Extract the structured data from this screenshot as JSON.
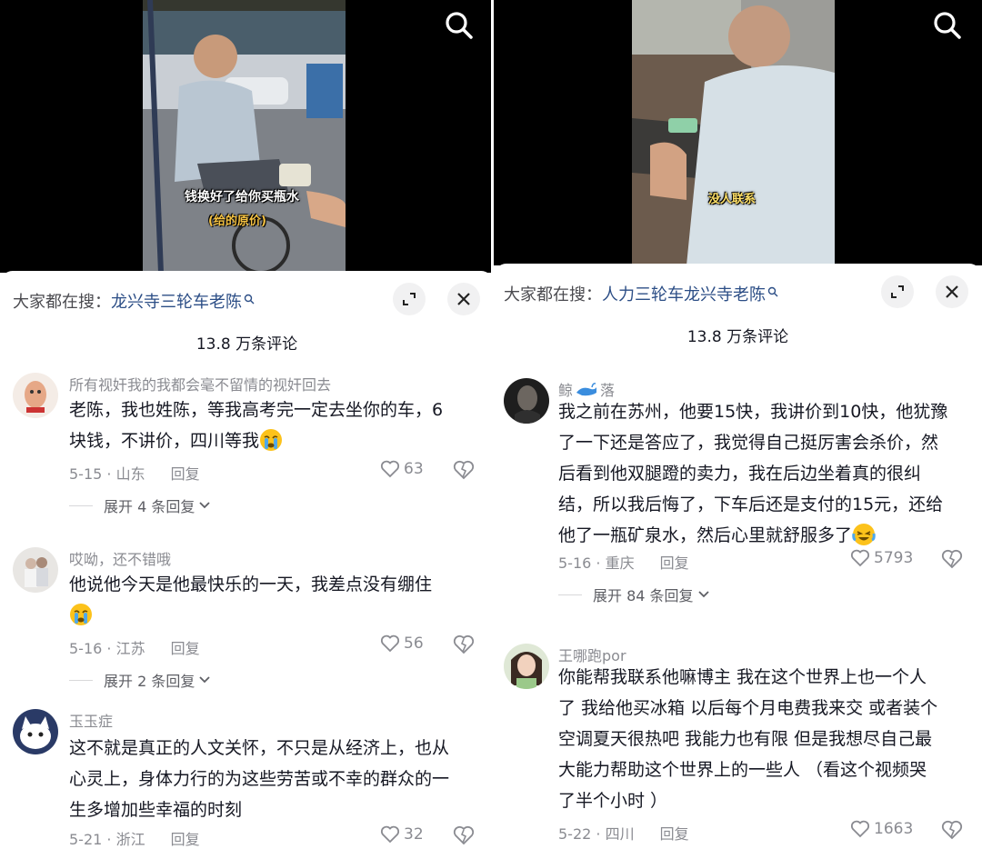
{
  "left": {
    "video": {
      "caption": "钱换好了给你买瓶水",
      "caption_sub": "(给的原价)"
    },
    "search": {
      "prefix": "大家都在搜：",
      "term": "龙兴寺三轮车老陈"
    },
    "count": "13.8 万条评论",
    "comments": [
      {
        "username": "所有视奸我的我都会毫不留情的视奸回去",
        "lines": [
          "老陈，我也姓陈，等我高考完一定去坐你的车，6",
          "块钱，不讲价，四川等我"
        ],
        "date_loc": "5-15 · 山东",
        "reply": "回复",
        "likes": "63",
        "expand": "展开 4 条回复"
      },
      {
        "username": "哎呦，还不错哦",
        "lines": [
          "他说他今天是他最快乐的一天，我差点没有绷住",
          ""
        ],
        "date_loc": "5-16 · 江苏",
        "reply": "回复",
        "likes": "56",
        "expand": "展开 2 条回复"
      },
      {
        "username": "玉玉症",
        "lines": [
          "这不就是真正的人文关怀，不只是从经济上，也从",
          "心灵上，身体力行的为这些劳苦或不幸的群众的一",
          "生多增加些幸福的时刻"
        ],
        "date_loc": "5-21 · 浙江",
        "reply": "回复",
        "likes": "32"
      }
    ]
  },
  "right": {
    "video": {
      "caption": "没人联系"
    },
    "search": {
      "prefix": "大家都在搜：",
      "term": "人力三轮车龙兴寺老陈"
    },
    "count": "13.8 万条评论",
    "comments": [
      {
        "username": "鲸",
        "username_suffix": "落",
        "lines": [
          "我之前在苏州，他要15快，我讲价到10快，他犹豫",
          "了一下还是答应了，我觉得自己挺厉害会杀价，然",
          "后看到他双腿蹬的卖力，我在后边坐着真的很纠",
          "结，所以我后悔了，下车后还是支付的15元，还给",
          "他了一瓶矿泉水，然后心里就舒服多了"
        ],
        "date_loc": "5-16 · 重庆",
        "reply": "回复",
        "likes": "5793",
        "expand": "展开 84 条回复"
      },
      {
        "username": "王哪跑por",
        "lines": [
          "你能帮我联系他嘛博主 我在这个世界上也一个人",
          "了  我给他买冰箱 以后每个月电费我来交 或者装个",
          "空调夏天很热吧 我能力也有限 但是我想尽自己最",
          "大能力帮助这个世界上的一些人 （看这个视频哭",
          "了半个小时 ）"
        ],
        "date_loc": "5-22 · 四川",
        "reply": "回复",
        "likes": "1663"
      }
    ]
  },
  "colors": {
    "link_blue": "#2c4e86",
    "muted": "#8a8b91",
    "text": "#161823"
  }
}
